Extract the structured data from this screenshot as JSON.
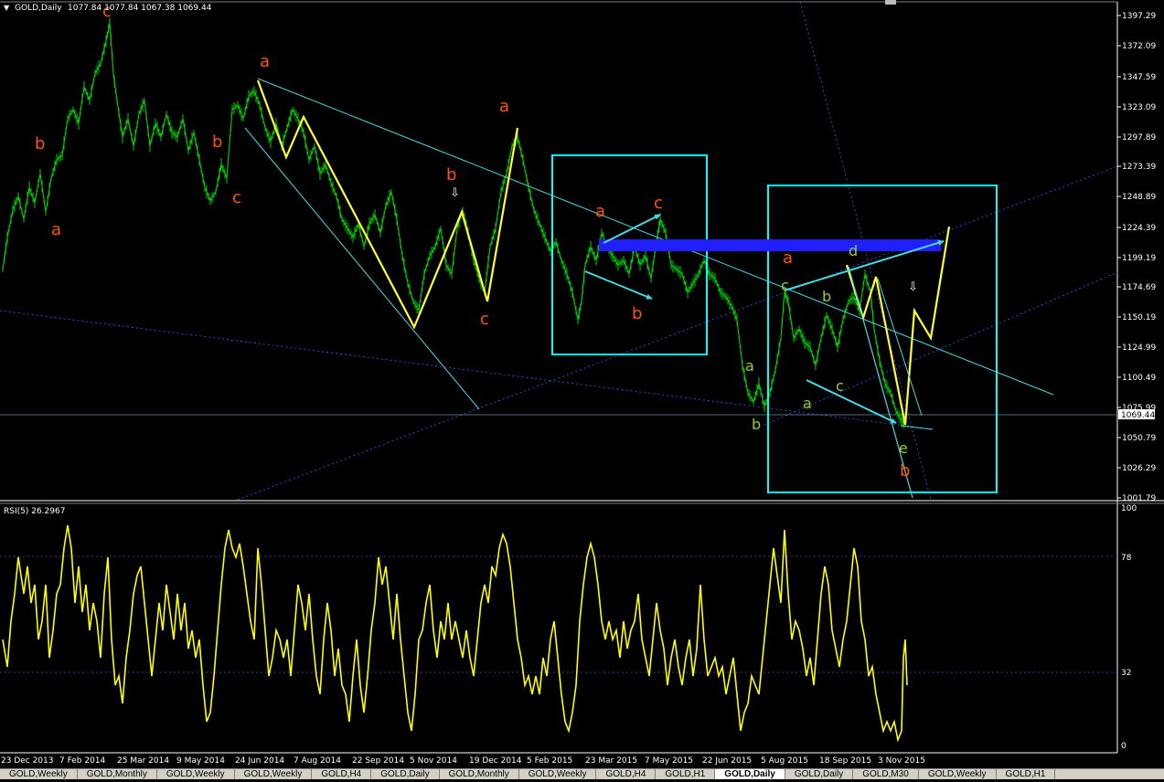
{
  "symbol_header": {
    "dropdown_glyph": "▼",
    "title": "GOLD,Daily",
    "ohlc": "1077.84 1077.84 1067.38 1069.44"
  },
  "indicator": {
    "title": "RSI(5) 26.2967",
    "levels": [
      "100",
      "78",
      "32",
      "0"
    ]
  },
  "price_axis": [
    "1397.29",
    "1372.09",
    "1347.59",
    "1323.09",
    "1297.89",
    "1273.39",
    "1248.89",
    "1224.39",
    "1199.19",
    "1174.69",
    "1150.19",
    "1124.99",
    "1100.49",
    "1075.99",
    "1050.79",
    "1026.29",
    "1001.79"
  ],
  "current_price": "1069.44",
  "date_axis": [
    "23 Dec 2013",
    "7 Feb 2014",
    "25 Mar 2014",
    "9 May 2014",
    "24 Jun 2014",
    "7 Aug 2014",
    "22 Sep 2014",
    "5 Nov 2014",
    "19 Dec 2014",
    "5 Feb 2015",
    "23 Mar 2015",
    "7 May 2015",
    "22 Jun 2015",
    "5 Aug 2015",
    "18 Sep 2015",
    "3 Nov 2015"
  ],
  "wave_labels": {
    "orange": [
      "c",
      "a",
      "b",
      "a",
      "b",
      "c",
      "a",
      "b",
      "c",
      "a",
      "c",
      "b",
      "a",
      "b"
    ],
    "green": [
      "c",
      "b",
      "d",
      "a",
      "b",
      "c",
      "a",
      "e"
    ]
  },
  "marker_glyph": "⇩",
  "colors": {
    "background": "#000000",
    "price_line": "#00d000",
    "wave_overlay": "#ffff33",
    "channel_line": "#49d9e3",
    "box": "#00ffff",
    "zone_bar": "#1f1fff",
    "orange_label": "#ff5500",
    "green_label": "#9acd32",
    "rsi_line": "#ffff00"
  },
  "tabs": [
    {
      "label": "GOLD,Weekly",
      "active": false
    },
    {
      "label": "GOLD,Monthly",
      "active": false
    },
    {
      "label": "GOLD,Weekly",
      "active": false
    },
    {
      "label": "GOLD,Weekly",
      "active": false
    },
    {
      "label": "GOLD,H4",
      "active": false
    },
    {
      "label": "GOLD,Daily",
      "active": false
    },
    {
      "label": "GOLD,Monthly",
      "active": false
    },
    {
      "label": "GOLD,Weekly",
      "active": false
    },
    {
      "label": "GOLD,H4",
      "active": false
    },
    {
      "label": "GOLD,H1",
      "active": false
    },
    {
      "label": "GOLD,Daily",
      "active": true
    },
    {
      "label": "GOLD,Daily",
      "active": false
    },
    {
      "label": "GOLD,M30",
      "active": false
    },
    {
      "label": "GOLD,Weekly",
      "active": false
    },
    {
      "label": "GOLD,H1",
      "active": false
    }
  ]
}
